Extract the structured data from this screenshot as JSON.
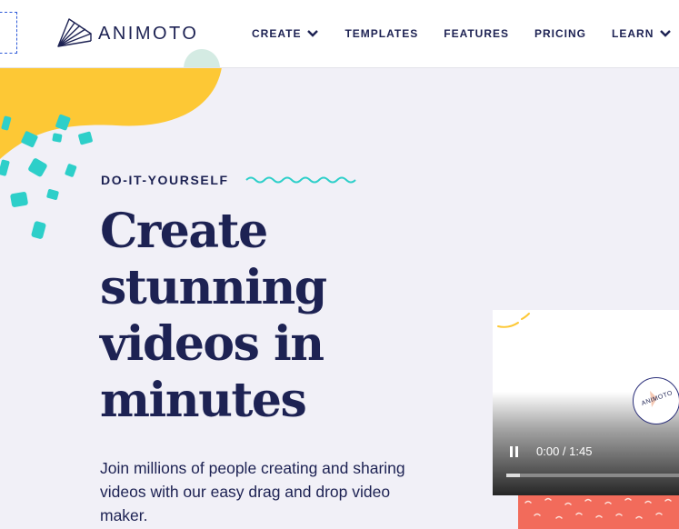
{
  "header": {
    "logo_text": "ANIMOTO",
    "nav": [
      {
        "label": "CREATE",
        "has_dropdown": true
      },
      {
        "label": "TEMPLATES",
        "has_dropdown": false
      },
      {
        "label": "FEATURES",
        "has_dropdown": false
      },
      {
        "label": "PRICING",
        "has_dropdown": false
      },
      {
        "label": "LEARN",
        "has_dropdown": true
      }
    ]
  },
  "hero": {
    "eyebrow": "DO-IT-YOURSELF",
    "title": "Create stunning videos in minutes",
    "description": "Join millions of people creating and sharing videos with our easy drag and drop video maker."
  },
  "video": {
    "badge_text": "ANIMOTO",
    "time_display": "0:00 / 1:45",
    "progress_fraction": 0.08,
    "state": "playing"
  },
  "colors": {
    "navy": "#1d2253",
    "yellow": "#fdc835",
    "teal": "#2dcfc9",
    "pink": "#ee4a7e",
    "mint": "#d4ebe3",
    "coral": "#f26b5b",
    "background": "#f1f0f7"
  }
}
